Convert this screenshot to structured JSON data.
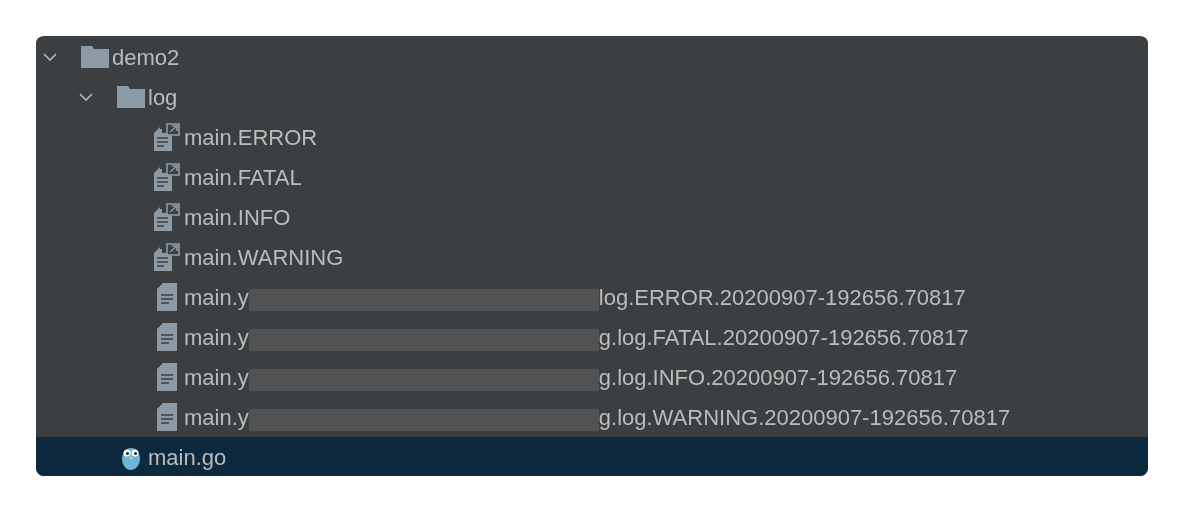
{
  "tree": [
    {
      "kind": "folder",
      "name": "demo2",
      "expanded": true,
      "selected": false,
      "children": [
        {
          "kind": "folder",
          "name": "log",
          "expanded": true,
          "selected": false,
          "children": [
            {
              "kind": "alias-file",
              "name": "main.ERROR",
              "selected": false
            },
            {
              "kind": "alias-file",
              "name": "main.FATAL",
              "selected": false
            },
            {
              "kind": "alias-file",
              "name": "main.INFO",
              "selected": false
            },
            {
              "kind": "alias-file",
              "name": "main.WARNING",
              "selected": false
            },
            {
              "kind": "text-file",
              "name": "main.y",
              "redacted": true,
              "suffix": "log.ERROR.20200907-192656.70817",
              "selected": false
            },
            {
              "kind": "text-file",
              "name": "main.y",
              "redacted": true,
              "suffix": "g.log.FATAL.20200907-192656.70817",
              "selected": false
            },
            {
              "kind": "text-file",
              "name": "main.y",
              "redacted": true,
              "suffix": "g.log.INFO.20200907-192656.70817",
              "selected": false
            },
            {
              "kind": "text-file",
              "name": "main.y",
              "redacted": true,
              "suffix": "g.log.WARNING.20200907-192656.70817",
              "selected": false
            }
          ]
        },
        {
          "kind": "go-file",
          "name": "main.go",
          "selected": true
        }
      ]
    }
  ]
}
